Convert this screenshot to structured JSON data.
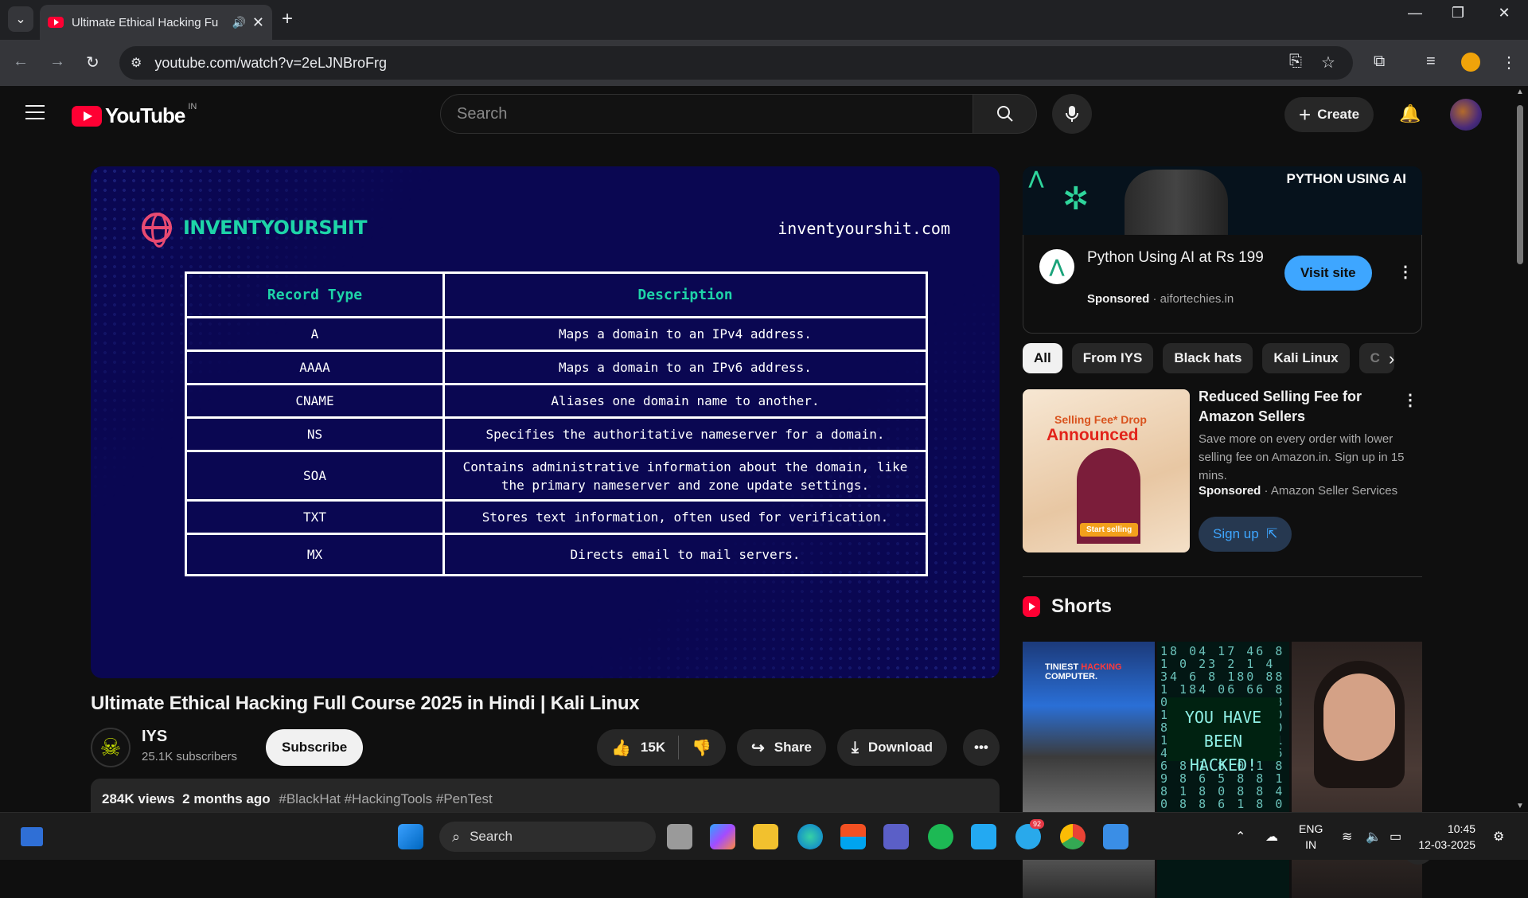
{
  "browser": {
    "tab_title": "Ultimate Ethical Hacking Fu",
    "url": "youtube.com/watch?v=2eLJNBroFrg"
  },
  "header": {
    "logo_text": "YouTube",
    "country_code": "IN",
    "search_placeholder": "Search",
    "create_label": "Create"
  },
  "video": {
    "brand": "INVENTYOURSHIT",
    "site": "inventyourshit.com",
    "table_headers": [
      "Record Type",
      "Description"
    ],
    "rows": [
      {
        "type": "A",
        "desc": "Maps a domain to an IPv4 address."
      },
      {
        "type": "AAAA",
        "desc": "Maps a domain to an IPv6 address."
      },
      {
        "type": "CNAME",
        "desc": "Aliases one domain name to another."
      },
      {
        "type": "NS",
        "desc": "Specifies the authoritative nameserver for a domain."
      },
      {
        "type": "SOA",
        "desc": "Contains administrative information about the domain, like the primary nameserver and zone update settings."
      },
      {
        "type": "TXT",
        "desc": "Stores text information, often used for verification."
      },
      {
        "type": "MX",
        "desc": "Directs email to mail servers."
      }
    ],
    "title": "Ultimate Ethical Hacking Full Course 2025 in Hindi | Kali Linux",
    "channel": "IYS",
    "subscribers": "25.1K subscribers",
    "subscribe_label": "Subscribe",
    "likes": "15K",
    "share_label": "Share",
    "download_label": "Download",
    "views": "284K views",
    "age": "2 months ago",
    "tags": "#BlackHat #HackingTools #PenTest"
  },
  "sidebar": {
    "ad1": {
      "banner_part1": "PYTHON",
      "banner_part2": " USING AI",
      "title": "Python Using AI at Rs 199",
      "sponsored": "Sponsored",
      "domain": " · aifortechies.in",
      "cta": "Visit site"
    },
    "chips": [
      "All",
      "From IYS",
      "Black hats",
      "Kali Linux",
      "C"
    ],
    "ad2": {
      "thumb_line1": "Selling Fee* Drop",
      "thumb_line2": "Announced",
      "thumb_cta": "Start selling",
      "title": "Reduced Selling Fee for Amazon Sellers",
      "desc": "Save more on every order with lower selling fee on Amazon.in. Sign up in 15 mins.",
      "sponsored": "Sponsored",
      "advertiser": " · Amazon Seller Services",
      "cta": "Sign up"
    },
    "shorts_label": "Shorts",
    "short1_text_a": "TINIEST ",
    "short1_text_b": "HACKING",
    "short1_text_c": "COMPUTER.",
    "short2_text": "YOU HAVE BEEN HACKED!"
  },
  "taskbar": {
    "search_label": "Search",
    "lang": "ENG",
    "region": "IN",
    "time": "10:45",
    "date": "12-03-2025",
    "telegram_badge": "92"
  }
}
